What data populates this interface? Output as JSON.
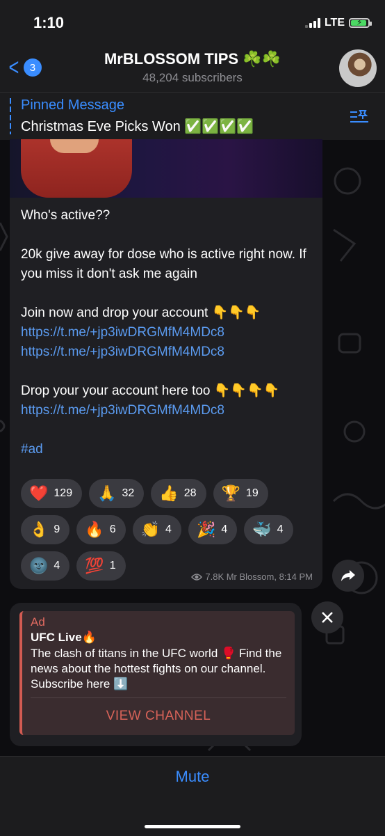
{
  "status": {
    "time": "1:10",
    "network": "LTE"
  },
  "header": {
    "back_count": "3",
    "title": "MrBLOSSOM TIPS ☘️☘️",
    "subtitle": "48,204 subscribers"
  },
  "pinned": {
    "label": "Pinned Message",
    "text": "Christmas Eve Picks Won ✅✅✅✅"
  },
  "message": {
    "p1": "Who's active??",
    "p2": "20k give away for dose who is active right now. If you miss it don't ask me again",
    "p3_text": "Join now and drop your account 👇👇👇",
    "p3_link1": "https://t.me/+jp3iwDRGMfM4MDc8",
    "p3_link2": "https://t.me/+jp3iwDRGMfM4MDc8",
    "p4_text": "Drop your your account here too 👇👇👇👇",
    "p4_link": "https://t.me/+jp3iwDRGMfM4MDc8",
    "hashtag": "#ad",
    "reactions": [
      {
        "emoji": "❤️",
        "count": "129"
      },
      {
        "emoji": "🙏",
        "count": "32"
      },
      {
        "emoji": "👍",
        "count": "28"
      },
      {
        "emoji": "🏆",
        "count": "19"
      },
      {
        "emoji": "👌",
        "count": "9"
      },
      {
        "emoji": "🔥",
        "count": "6"
      },
      {
        "emoji": "👏",
        "count": "4"
      },
      {
        "emoji": "🎉",
        "count": "4"
      },
      {
        "emoji": "🐳",
        "count": "4"
      },
      {
        "emoji": "🌚",
        "count": "4"
      },
      {
        "emoji": "💯",
        "count": "1"
      }
    ],
    "meta": "7.8K Mr Blossom, 8:14 PM"
  },
  "ad": {
    "label": "Ad",
    "title": "UFC Live🔥",
    "text": "The clash of titans in the UFC world 🥊 Find the news about the hottest fights on our channel. Subscribe here ⬇️",
    "button": "VIEW CHANNEL"
  },
  "bottom": {
    "mute_label": "Mute"
  },
  "colors": {
    "accent": "#3a8dff",
    "ad_accent": "#d25b52",
    "background": "#0d0d10"
  },
  "icons": [
    "back-chevron-icon",
    "pin-list-icon",
    "eye-icon",
    "share-arrow-icon",
    "close-icon"
  ]
}
